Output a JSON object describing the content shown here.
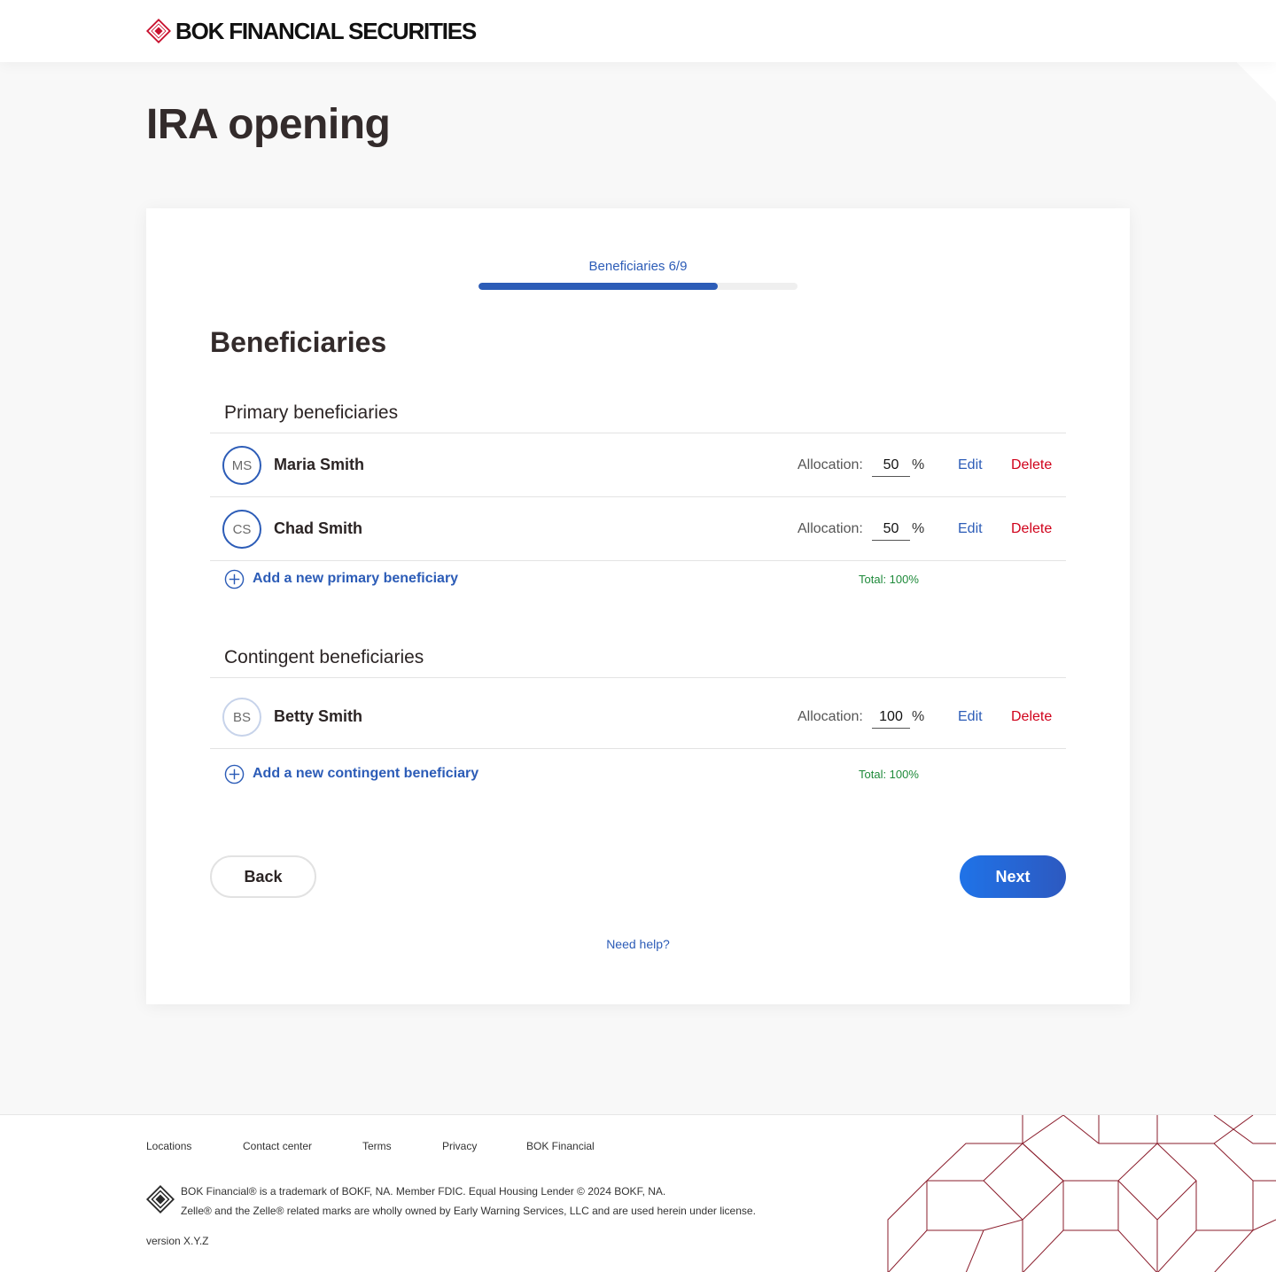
{
  "header": {
    "brand": "BOK FINANCIAL SECURITIES"
  },
  "page": {
    "title": "IRA opening"
  },
  "progress": {
    "label": "Beneficiaries 6/9",
    "current": 6,
    "total": 9,
    "fraction": 0.75
  },
  "section": {
    "title": "Beneficiaries"
  },
  "primary": {
    "title": "Primary beneficiaries",
    "items": [
      {
        "initials": "MS",
        "name": "Maria Smith",
        "allocation_label": "Allocation:",
        "allocation": "50",
        "pct": "%",
        "edit": "Edit",
        "delete": "Delete"
      },
      {
        "initials": "CS",
        "name": "Chad Smith",
        "allocation_label": "Allocation:",
        "allocation": "50",
        "pct": "%",
        "edit": "Edit",
        "delete": "Delete"
      }
    ],
    "add_label": "Add a new primary beneficiary",
    "total": "Total: 100%"
  },
  "contingent": {
    "title": "Contingent beneficiaries",
    "items": [
      {
        "initials": "BS",
        "name": "Betty Smith",
        "allocation_label": "Allocation:",
        "allocation": "100",
        "pct": "%",
        "edit": "Edit",
        "delete": "Delete"
      }
    ],
    "add_label": "Add a new contingent beneficiary",
    "total": "Total: 100%"
  },
  "actions": {
    "back": "Back",
    "next": "Next",
    "help": "Need help?"
  },
  "footer": {
    "links": [
      "Locations",
      "Contact center",
      "Terms",
      "Privacy",
      "BOK Financial"
    ],
    "legal_line1": "BOK Financial® is a trademark of BOKF, NA. Member FDIC. Equal Housing Lender  © 2024 BOKF, NA.",
    "legal_line2": "Zelle® and the Zelle® related marks are wholly owned by Early Warning Services, LLC and are used herein under license.",
    "version": "version X.Y.Z"
  },
  "colors": {
    "brand_red": "#c8102e",
    "link_blue": "#2c5cb7",
    "delete_red": "#d0021b",
    "total_green": "#1e8a3a",
    "next_button": "#1f73e8",
    "pattern": "#8a1c2b"
  }
}
